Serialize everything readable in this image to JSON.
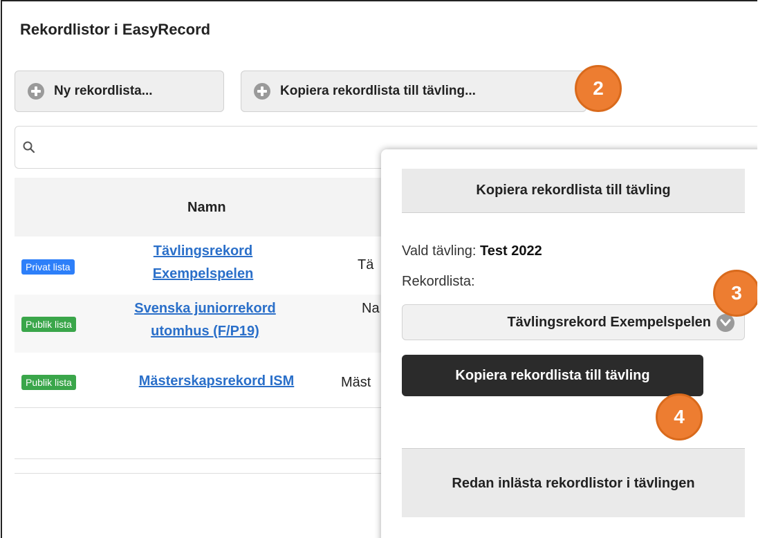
{
  "page": {
    "title": "Rekordlistor i EasyRecord"
  },
  "toolbar": {
    "new_list_label": "Ny rekordlista...",
    "copy_list_label": "Kopiera rekordlista till tävling..."
  },
  "search": {
    "placeholder": ""
  },
  "table": {
    "column_name": "Namn",
    "rows": [
      {
        "badge": "Privat lista",
        "badge_type": "private",
        "name_line1": "Tävlingsrekord",
        "name_line2": "Exempelspelen",
        "description": "Tä"
      },
      {
        "badge": "Publik lista",
        "badge_type": "public",
        "name_line1": "Svenska juniorrekord",
        "name_line2": "utomhus (F/P19)",
        "description": "Na"
      },
      {
        "badge": "Publik lista",
        "badge_type": "public",
        "name_line1": "Mästerskapsrekord ISM",
        "name_line2": "",
        "description": "Mäst"
      }
    ]
  },
  "popover": {
    "header": "Kopiera rekordlista till tävling",
    "competition_label": "Vald tävling:",
    "competition_value": "Test 2022",
    "record_list_label": "Rekordlista:",
    "record_list_selected": "Tävlingsrekord Exempelspelen",
    "action_label": "Kopiera rekordlista till tävling",
    "loaded_label": "Redan inlästa rekordlistor i tävlingen"
  },
  "annotations": {
    "step2": "2",
    "step3": "3",
    "step4": "4",
    "color": "#ed7d31"
  },
  "colors": {
    "link": "#2a6fc9",
    "private_badge": "#2d7ff9",
    "public_badge": "#3aa64a",
    "action_button": "#2b2b2b"
  }
}
